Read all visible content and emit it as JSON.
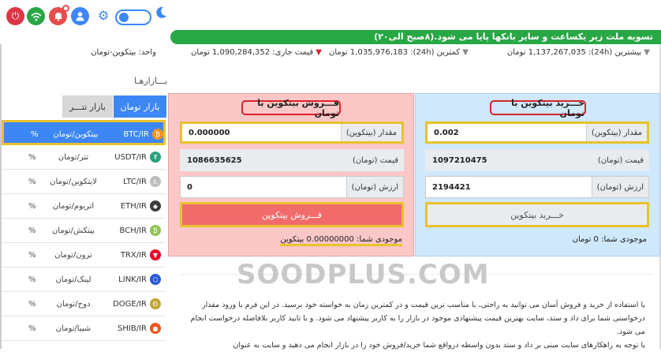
{
  "colors": {
    "buy_panel_bg": "#cfe8fc",
    "sell_panel_bg": "#fbc7c7",
    "highlight": "#e8c22c",
    "title_border": "#d9232d",
    "banner": "#28a745",
    "market_tab_active": "#3d87f5"
  },
  "banner": {
    "text": "تسویه ملت زیر یکساعت و سایر بانکها پایا می شود.(۸صبح الی۲۰)"
  },
  "stats": {
    "highest": "بیشترین (24h): 1,137,267,035 تومان",
    "lowest": "کمترین (24h): 1,035,976,183 تومان",
    "current": "قیمت جاری: 1,090,284,352 تومان",
    "unit": "واحد: بیتکوین-تومان"
  },
  "markets": {
    "title": "بـــازارهـا",
    "tabs": [
      {
        "label": "بازار تومان"
      },
      {
        "label": "بازار تتـــر"
      }
    ],
    "rows": [
      {
        "symbol": "BTC/IR",
        "name": "بیتکوین/تومان",
        "pct": "%",
        "icon": "bitcoin-icon",
        "color": "#f7931a",
        "glyph": "₿"
      },
      {
        "symbol": "USDT/IR",
        "name": "تتر/تومان",
        "pct": "%",
        "icon": "tether-icon",
        "color": "#26a17b",
        "glyph": "₮"
      },
      {
        "symbol": "LTC/IR",
        "name": "لایتکوین/تومان",
        "pct": "%",
        "icon": "litecoin-icon",
        "color": "#bebebe",
        "glyph": "Ł"
      },
      {
        "symbol": "ETH/IR",
        "name": "اتریوم/تومان",
        "pct": "%",
        "icon": "ethereum-icon",
        "color": "#3c3c3d",
        "glyph": "◆"
      },
      {
        "symbol": "BCH/IR",
        "name": "بیتکش/تومان",
        "pct": "%",
        "icon": "bitcoin-cash-icon",
        "color": "#8dc351",
        "glyph": "₿"
      },
      {
        "symbol": "TRX/IR",
        "name": "ترون/تومان",
        "pct": "%",
        "icon": "tron-icon",
        "color": "#eb0029",
        "glyph": "▼"
      },
      {
        "symbol": "LINK/IR",
        "name": "لینک/تومان",
        "pct": "%",
        "icon": "chainlink-icon",
        "color": "#2a5ada",
        "glyph": "⬡"
      },
      {
        "symbol": "DOGE/IR",
        "name": "دوج/تومان",
        "pct": "%",
        "icon": "dogecoin-icon",
        "color": "#c2a633",
        "glyph": "Ð"
      },
      {
        "symbol": "SHIB/IR",
        "name": "شیبا/تومان",
        "pct": "%",
        "icon": "shiba-icon",
        "color": "#f0541c",
        "glyph": "●"
      }
    ]
  },
  "buy": {
    "title": "خـــرید بیتکوین با تومان",
    "amount_label": "مقدار (بیتکوین)",
    "amount_value": "0.002",
    "price_label": "قیمت (تومان)",
    "price_value": "1097210475",
    "total_label": "ارزش (تومان)",
    "total_value": "2194421",
    "button": "خـــرید بیتکوین",
    "balance": "موجودی شما: 0 تومان"
  },
  "sell": {
    "title": "فـــروش بیتکوین با تومان",
    "amount_label": "مقدار (بیتکوین)",
    "amount_value": "0.000000",
    "price_label": "قیمت (تومان)",
    "price_value": "1086635625",
    "total_label": "ارزش (تومان)",
    "total_value": "0",
    "button": "فـــروش بیتکوین",
    "balance": "موجودی شما: 0.00000000 بیتکوین"
  },
  "watermark": "SOODPLUS.COM",
  "info": {
    "p1": "با استفاده از خرید و فروش آسان می توانید به راحتی، با مناسب ترین قیمت و در کمترین زمان به خواسته خود برسید. در این فرم با ورود مقدار درخواستی شما برای داد و ستد، سایت بهترین قیمت پیشنهادی موجود در بازار را به کاربر پیشنهاد می شود. و با تایید کاربر بلافاصله درخواست انجام می شود.",
    "p2": "با توجه به راهکارهای سایت مبنی بر داد و ستد بدون واسطه درواقع شما خرید/فروش خود را در بازار انجام می دهید و سایت به عنوان"
  }
}
